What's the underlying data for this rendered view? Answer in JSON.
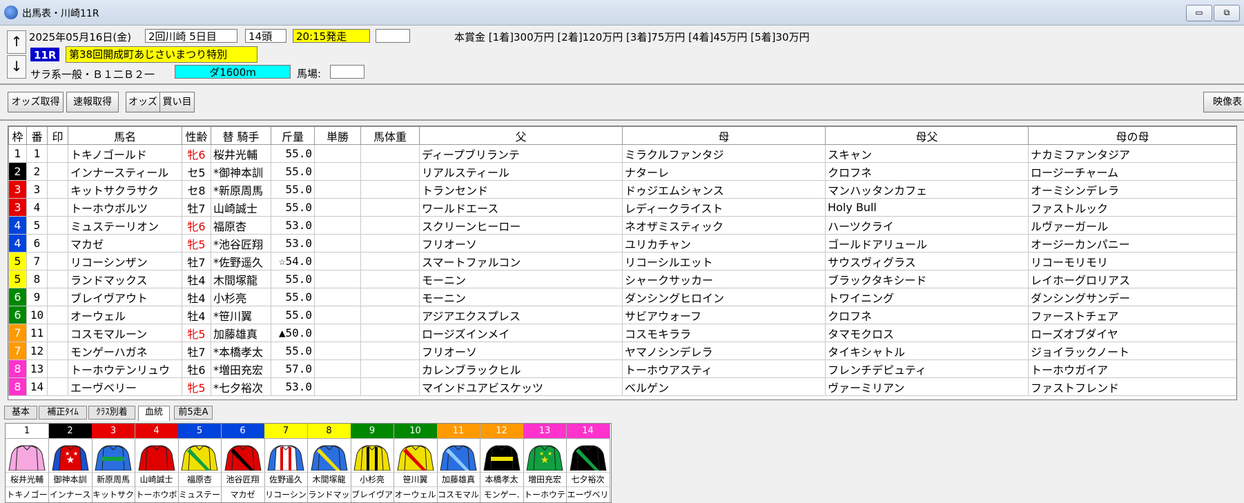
{
  "window": {
    "title": "出馬表・川崎11R",
    "minimize_label": "▭",
    "restore_label": "⧉"
  },
  "info": {
    "up_label": "↑",
    "down_label": "↓",
    "date": "2025年05月16日(金)",
    "meeting": "2回川崎 5日目",
    "runners": "14頭",
    "post_time": "20:15発走",
    "extra_box": "",
    "race_no": "11R",
    "race_name": "第38回開成町あじさいまつり特別",
    "class": "サラ系一般・Ｂ１二Ｂ２一",
    "distance": "ダ1600m",
    "track_label": "馬場:",
    "track_value": "",
    "prize": "本賞金 [1着]300万円 [2着]120万円 [3着]75万円 [4着]45万円 [5着]30万円"
  },
  "toolbar": {
    "odds_fetch": "オッズ取得",
    "quick_fetch": "速報取得",
    "odds": "オッズ",
    "bet": "買い目",
    "video": "映像表"
  },
  "table": {
    "headers": {
      "waku": "枠",
      "ban": "番",
      "mark": "印",
      "horse": "馬名",
      "sexage": "性齢",
      "jockey": "替 騎手",
      "weight": "斤量",
      "win": "単勝",
      "bodyweight": "馬体重",
      "sire": "父",
      "dam": "母",
      "damsire": "母父",
      "damdam": "母の母"
    },
    "rows": [
      {
        "waku": "1",
        "ban": "1",
        "mark": "",
        "horse": "トキノゴールド",
        "sexage": "牝6",
        "jockey": " 桜井光輔",
        "weight": "55.0",
        "win": "",
        "bodyweight": "",
        "sire": "ディープブリランテ",
        "dam": "ミラクルファンタジ",
        "damsire": "スキャン",
        "damdam": "ナカミファンタジア"
      },
      {
        "waku": "2",
        "ban": "2",
        "mark": "",
        "horse": "インナースティール",
        "sexage": "セ5",
        "jockey": "*御神本訓",
        "weight": "55.0",
        "win": "",
        "bodyweight": "",
        "sire": "リアルスティール",
        "dam": "ナターレ",
        "damsire": "クロフネ",
        "damdam": "ロージーチャーム"
      },
      {
        "waku": "3",
        "ban": "3",
        "mark": "",
        "horse": "キットサクラサク",
        "sexage": "セ8",
        "jockey": "*新原周馬",
        "weight": "55.0",
        "win": "",
        "bodyweight": "",
        "sire": "トランセンド",
        "dam": "ドゥジエムシャンス",
        "damsire": "マンハッタンカフェ",
        "damdam": "オーミシンデレラ"
      },
      {
        "waku": "3",
        "ban": "4",
        "mark": "",
        "horse": "トーホウボルツ",
        "sexage": "牡7",
        "jockey": " 山崎誠士",
        "weight": "55.0",
        "win": "",
        "bodyweight": "",
        "sire": "ワールドエース",
        "dam": "レディークライスト",
        "damsire": "Holy Bull",
        "damdam": "ファストルック"
      },
      {
        "waku": "4",
        "ban": "5",
        "mark": "",
        "horse": "ミュステーリオン",
        "sexage": "牝6",
        "jockey": " 福原杏",
        "weight": "53.0",
        "win": "",
        "bodyweight": "",
        "sire": "スクリーンヒーロー",
        "dam": "ネオザミスティック",
        "damsire": "ハーツクライ",
        "damdam": "ルヴァーガール"
      },
      {
        "waku": "4",
        "ban": "6",
        "mark": "",
        "horse": "マカゼ",
        "sexage": "牝5",
        "jockey": "*池谷匠翔",
        "weight": "53.0",
        "win": "",
        "bodyweight": "",
        "sire": "フリオーソ",
        "dam": "ユリカチャン",
        "damsire": "ゴールドアリュール",
        "damdam": "オージーカンパニー"
      },
      {
        "waku": "5",
        "ban": "7",
        "mark": "",
        "horse": "リコーシンザン",
        "sexage": "牡7",
        "jockey": "*佐野遥久",
        "weight": "☆54.0",
        "win": "",
        "bodyweight": "",
        "sire": "スマートファルコン",
        "dam": "リコーシルエット",
        "damsire": "サウスヴィグラス",
        "damdam": "リコーモリモリ"
      },
      {
        "waku": "5",
        "ban": "8",
        "mark": "",
        "horse": "ランドマックス",
        "sexage": "牡4",
        "jockey": " 木間塚龍",
        "weight": "55.0",
        "win": "",
        "bodyweight": "",
        "sire": "モーニン",
        "dam": "シャークサッカー",
        "damsire": "ブラックタキシード",
        "damdam": "レイホーグロリアス"
      },
      {
        "waku": "6",
        "ban": "9",
        "mark": "",
        "horse": "ブレイヴアウト",
        "sexage": "牡4",
        "jockey": " 小杉亮",
        "weight": "55.0",
        "win": "",
        "bodyweight": "",
        "sire": "モーニン",
        "dam": "ダンシングヒロイン",
        "damsire": "トワイニング",
        "damdam": "ダンシングサンデー"
      },
      {
        "waku": "6",
        "ban": "10",
        "mark": "",
        "horse": "オーウェル",
        "sexage": "牡4",
        "jockey": "*笹川翼",
        "weight": "55.0",
        "win": "",
        "bodyweight": "",
        "sire": "アジアエクスプレス",
        "dam": "サビアウォーフ",
        "damsire": "クロフネ",
        "damdam": "ファーストチェア"
      },
      {
        "waku": "7",
        "ban": "11",
        "mark": "",
        "horse": "コスモマルーン",
        "sexage": "牝5",
        "jockey": " 加藤雄真",
        "weight": "▲50.0",
        "win": "",
        "bodyweight": "",
        "sire": "ロージズインメイ",
        "dam": "コスモキララ",
        "damsire": "タマモクロス",
        "damdam": "ローズオブダイヤ"
      },
      {
        "waku": "7",
        "ban": "12",
        "mark": "",
        "horse": "モンゲーハガネ",
        "sexage": "牡7",
        "jockey": "*本橋孝太",
        "weight": "55.0",
        "win": "",
        "bodyweight": "",
        "sire": "フリオーソ",
        "dam": "ヤマノシンデレラ",
        "damsire": "タイキシャトル",
        "damdam": "ジョイラックノート"
      },
      {
        "waku": "8",
        "ban": "13",
        "mark": "",
        "horse": "トーホウテンリュウ",
        "sexage": "牡6",
        "jockey": "*増田充宏",
        "weight": "57.0",
        "win": "",
        "bodyweight": "",
        "sire": "カレンブラックヒル",
        "dam": "トーホウアスティ",
        "damsire": "フレンチデピュティ",
        "damdam": "トーホウガイア"
      },
      {
        "waku": "8",
        "ban": "14",
        "mark": "",
        "horse": "エーヴベリー",
        "sexage": "牝5",
        "jockey": "*七夕裕次",
        "weight": "53.0",
        "win": "",
        "bodyweight": "",
        "sire": "マインドユアビスケッツ",
        "dam": "ベルゲン",
        "damsire": "ヴァーミリアン",
        "damdam": "ファストフレンド"
      }
    ]
  },
  "waku_colors": {
    "1": {
      "bg": "#ffffff",
      "fg": "#000000"
    },
    "2": {
      "bg": "#000000",
      "fg": "#ffffff"
    },
    "3": {
      "bg": "#e60000",
      "fg": "#ffffff"
    },
    "4": {
      "bg": "#0044dd",
      "fg": "#ffffff"
    },
    "5": {
      "bg": "#ffff00",
      "fg": "#000000"
    },
    "6": {
      "bg": "#008800",
      "fg": "#ffffff"
    },
    "7": {
      "bg": "#ff9900",
      "fg": "#ffffff"
    },
    "8": {
      "bg": "#ff33cc",
      "fg": "#ffffff"
    }
  },
  "colors": {
    "post_time_bg": "#ffff00",
    "race_no_bg": "#0000cc",
    "race_name_bg": "#ffff00",
    "distance_bg": "#00ffff",
    "mare_text": "#e60000"
  },
  "tabs": [
    {
      "label": "基本",
      "active": false
    },
    {
      "label": "補正ﾀｲﾑ",
      "active": false
    },
    {
      "label": "ｸﾗｽ別着",
      "active": false
    },
    {
      "label": "血統",
      "active": true
    },
    {
      "label": "前5走A",
      "active": false
    }
  ],
  "silks": [
    {
      "num": "1",
      "jockey": "桜井光輔",
      "horse": "トキノゴー",
      "body": "#f7a8e0",
      "sleeve": "#f7a8e0",
      "accent": "#f7a8e0",
      "pattern": "plain"
    },
    {
      "num": "2",
      "jockey": "御神本訓",
      "horse": "インナース",
      "body": "#e00000",
      "sleeve": "#1a4fd0",
      "accent": "#ffffff",
      "pattern": "stars"
    },
    {
      "num": "3",
      "jockey": "新原周馬",
      "horse": "キットサク",
      "body": "#2a6fe0",
      "sleeve": "#2a6fe0",
      "accent": "#10a040",
      "pattern": "band"
    },
    {
      "num": "4",
      "jockey": "山崎誠士",
      "horse": "トーホウボ",
      "body": "#e00000",
      "sleeve": "#e00000",
      "accent": "#e00000",
      "pattern": "plain"
    },
    {
      "num": "5",
      "jockey": "福原杏",
      "horse": "ミュステー",
      "body": "#f0e000",
      "sleeve": "#f0e000",
      "accent": "#10a040",
      "pattern": "sash"
    },
    {
      "num": "6",
      "jockey": "池谷匠翔",
      "horse": "マカゼ",
      "body": "#e00000",
      "sleeve": "#e00000",
      "accent": "#000000",
      "pattern": "sash"
    },
    {
      "num": "7",
      "jockey": "佐野遥久",
      "horse": "リコーシン",
      "body": "#ffffff",
      "sleeve": "#2a6fe0",
      "accent": "#e00000",
      "pattern": "stripes"
    },
    {
      "num": "8",
      "jockey": "木間塚龍",
      "horse": "ランドマッ",
      "body": "#2a6fe0",
      "sleeve": "#2a6fe0",
      "accent": "#f0e000",
      "pattern": "sash"
    },
    {
      "num": "9",
      "jockey": "小杉亮",
      "horse": "ブレイヴア",
      "body": "#f0e000",
      "sleeve": "#f0e000",
      "accent": "#000000",
      "pattern": "stripes"
    },
    {
      "num": "10",
      "jockey": "笹川翼",
      "horse": "オーウェル",
      "body": "#f0e000",
      "sleeve": "#f0e000",
      "accent": "#e00000",
      "pattern": "sash"
    },
    {
      "num": "11",
      "jockey": "加藤雄真",
      "horse": "コスモマル",
      "body": "#2a6fe0",
      "sleeve": "#2a6fe0",
      "accent": "#8ec8ff",
      "pattern": "sash"
    },
    {
      "num": "12",
      "jockey": "本橋孝太",
      "horse": "モンゲー.",
      "body": "#000000",
      "sleeve": "#000000",
      "accent": "#f0e000",
      "pattern": "band"
    },
    {
      "num": "13",
      "jockey": "増田充宏",
      "horse": "トーホウテ",
      "body": "#10a040",
      "sleeve": "#10a040",
      "accent": "#f0e000",
      "pattern": "stars"
    },
    {
      "num": "14",
      "jockey": "七夕裕次",
      "horse": "エーヴベリ",
      "body": "#000000",
      "sleeve": "#000000",
      "accent": "#10a040",
      "pattern": "sash"
    }
  ]
}
